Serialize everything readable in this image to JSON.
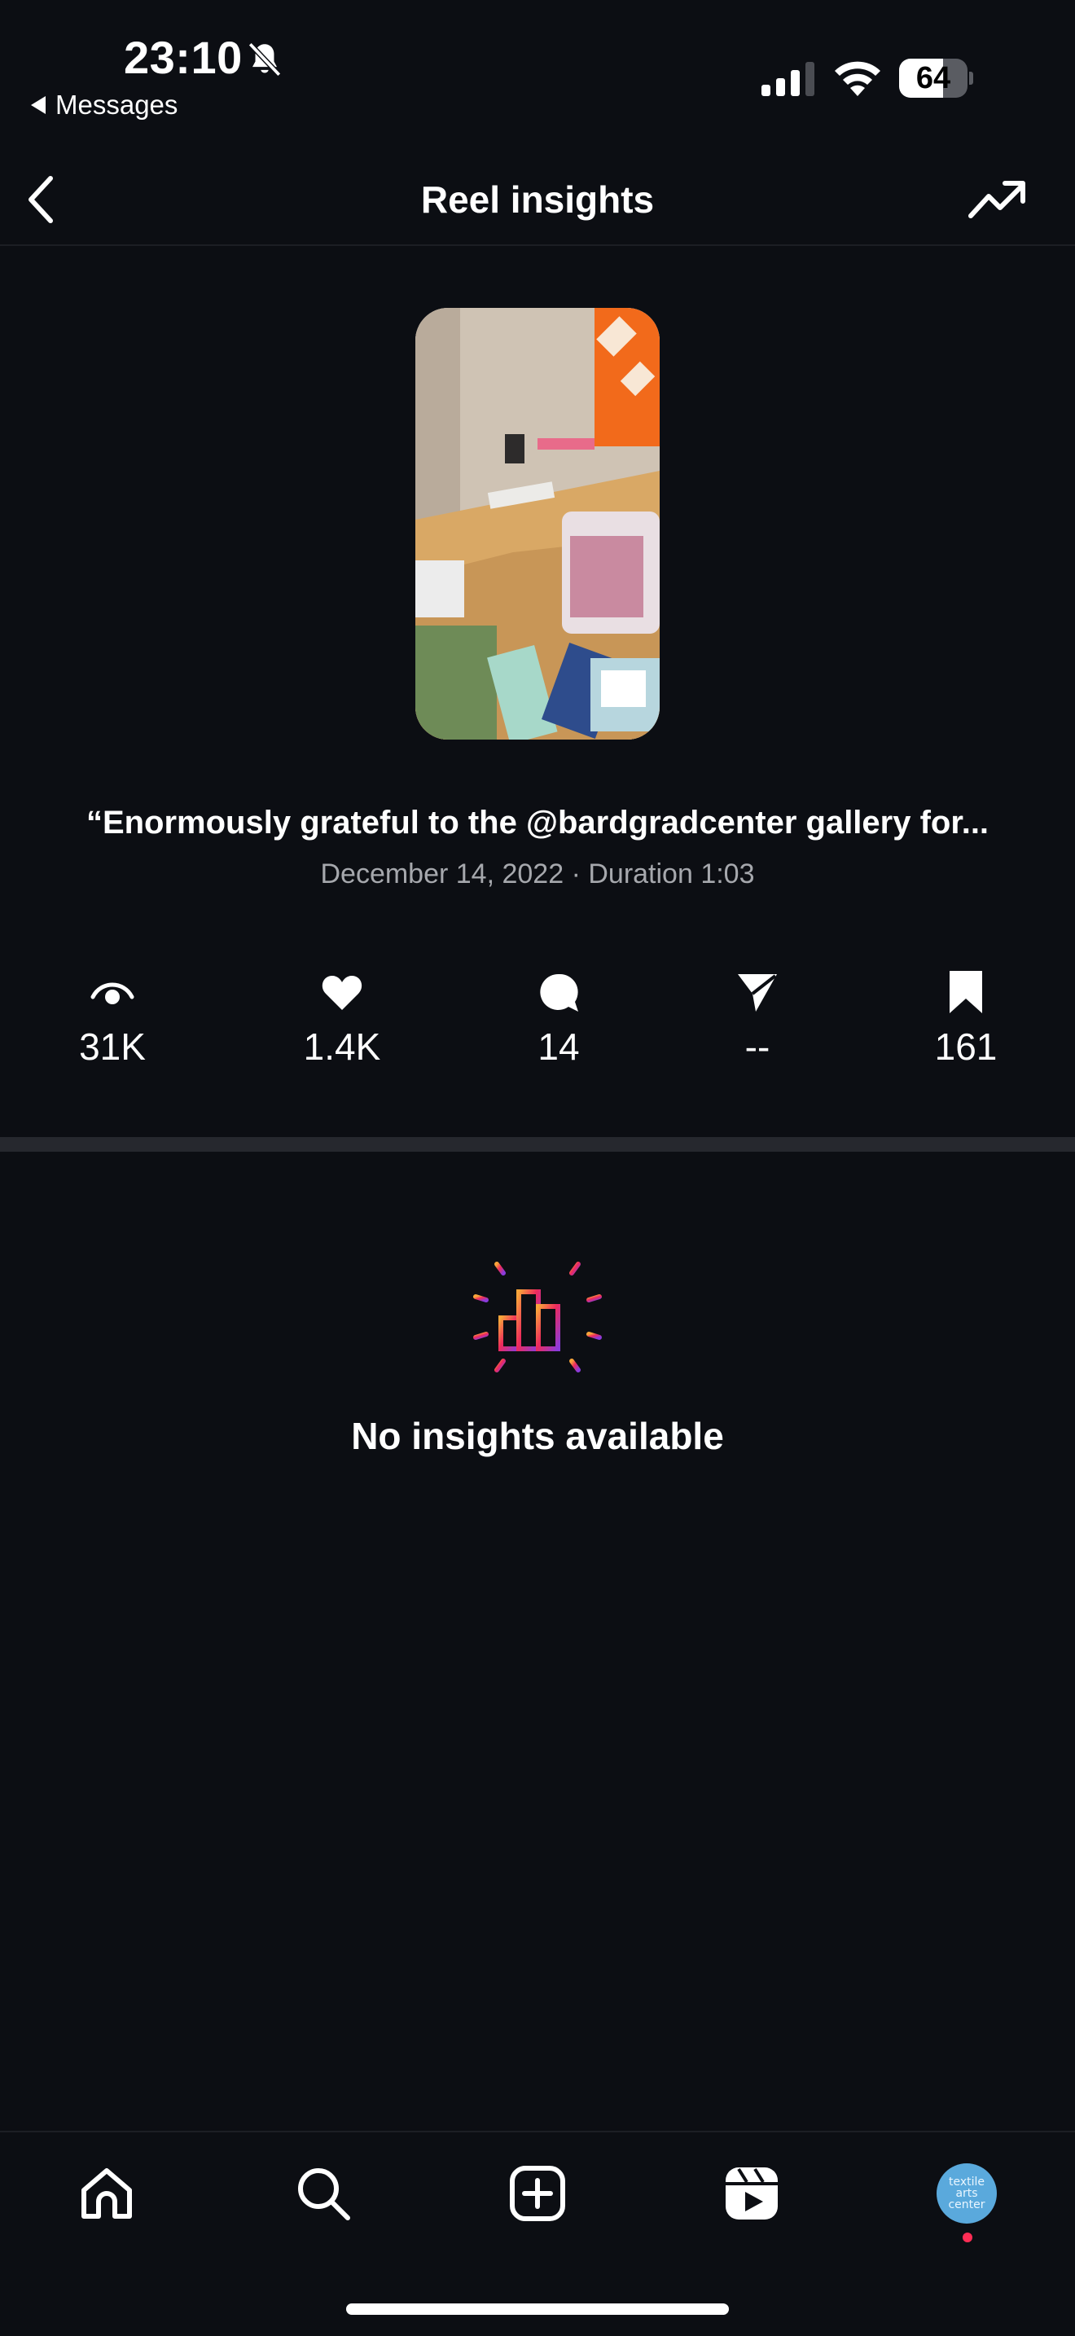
{
  "status_bar": {
    "time": "23:10",
    "back_app_label": "Messages",
    "battery_percent": "64",
    "battery_level": 0.64,
    "icons": [
      "bell-slash-icon",
      "cellular-signal-icon",
      "wifi-icon",
      "battery-icon"
    ]
  },
  "header": {
    "title": "Reel insights",
    "back_icon": "chevron-left-icon",
    "trend_icon": "trending-up-icon"
  },
  "reel": {
    "caption": "“Enormously grateful to the @bardgradcenter gallery for...",
    "date": "December 14, 2022",
    "separator": "·",
    "duration_label": "Duration 1:03"
  },
  "stats": [
    {
      "icon": "eye-icon",
      "value": "31K"
    },
    {
      "icon": "heart-icon",
      "value": "1.4K"
    },
    {
      "icon": "comment-icon",
      "value": "14"
    },
    {
      "icon": "share-icon",
      "value": "--"
    },
    {
      "icon": "bookmark-icon",
      "value": "161"
    }
  ],
  "empty_state": {
    "icon": "insights-chart-icon",
    "message": "No insights available"
  },
  "bottom_nav": {
    "items": [
      "home-icon",
      "search-icon",
      "create-icon",
      "reels-icon",
      "profile-avatar"
    ],
    "avatar_text": [
      "textile",
      "arts",
      "center"
    ]
  },
  "colors": {
    "background": "#0c0e13",
    "avatar": "#5aa9dc",
    "notification_dot": "#ff2d55"
  }
}
